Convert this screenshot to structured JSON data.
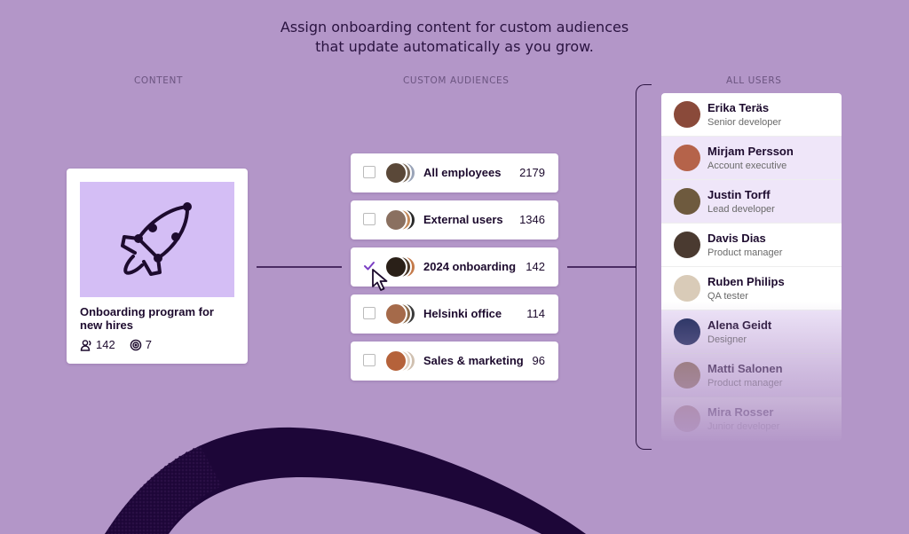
{
  "headline": {
    "line1": "Assign onboarding content for custom audiences",
    "line2": "that update automatically as you grow."
  },
  "columns": {
    "content": "CONTENT",
    "audiences": "CUSTOM AUDIENCES",
    "users": "ALL USERS"
  },
  "content_card": {
    "title_line1": "Onboarding program for",
    "title_line2": "new hires",
    "learners_icon": "people-icon",
    "learners_count": "142",
    "modules_icon": "target-icon",
    "modules_count": "7",
    "thumbnail_icon": "rocket-icon",
    "thumbnail_color": "#d4bef5"
  },
  "audiences": [
    {
      "name": "All employees",
      "count": "2179",
      "checked": false
    },
    {
      "name": "External users",
      "count": "1346",
      "checked": false
    },
    {
      "name": "2024 onboarding",
      "count": "142",
      "checked": true
    },
    {
      "name": "Helsinki office",
      "count": "114",
      "checked": false
    },
    {
      "name": "Sales & marketing",
      "count": "96",
      "checked": false
    }
  ],
  "users": [
    {
      "name": "Erika Teräs",
      "role": "Senior developer",
      "avatar_color": "#8a4a3a"
    },
    {
      "name": "Mirjam Persson",
      "role": "Account executive",
      "avatar_color": "#b5634a"
    },
    {
      "name": "Justin Torff",
      "role": "Lead developer",
      "avatar_color": "#6e5a3e"
    },
    {
      "name": "Davis Dias",
      "role": "Product manager",
      "avatar_color": "#4a3a30"
    },
    {
      "name": "Ruben Philips",
      "role": "QA tester",
      "avatar_color": "#d9cbb8"
    },
    {
      "name": "Alena Geidt",
      "role": "Designer",
      "avatar_color": "#1c2a5a"
    },
    {
      "name": "Matti Salonen",
      "role": "Product manager",
      "avatar_color": "#8a6a4a"
    },
    {
      "name": "Mira Rosser",
      "role": "Junior developer",
      "avatar_color": "#a37a6a"
    }
  ],
  "colors": {
    "background": "#b396c8",
    "accent": "#7b3fc4",
    "dark": "#1d0b2e"
  }
}
